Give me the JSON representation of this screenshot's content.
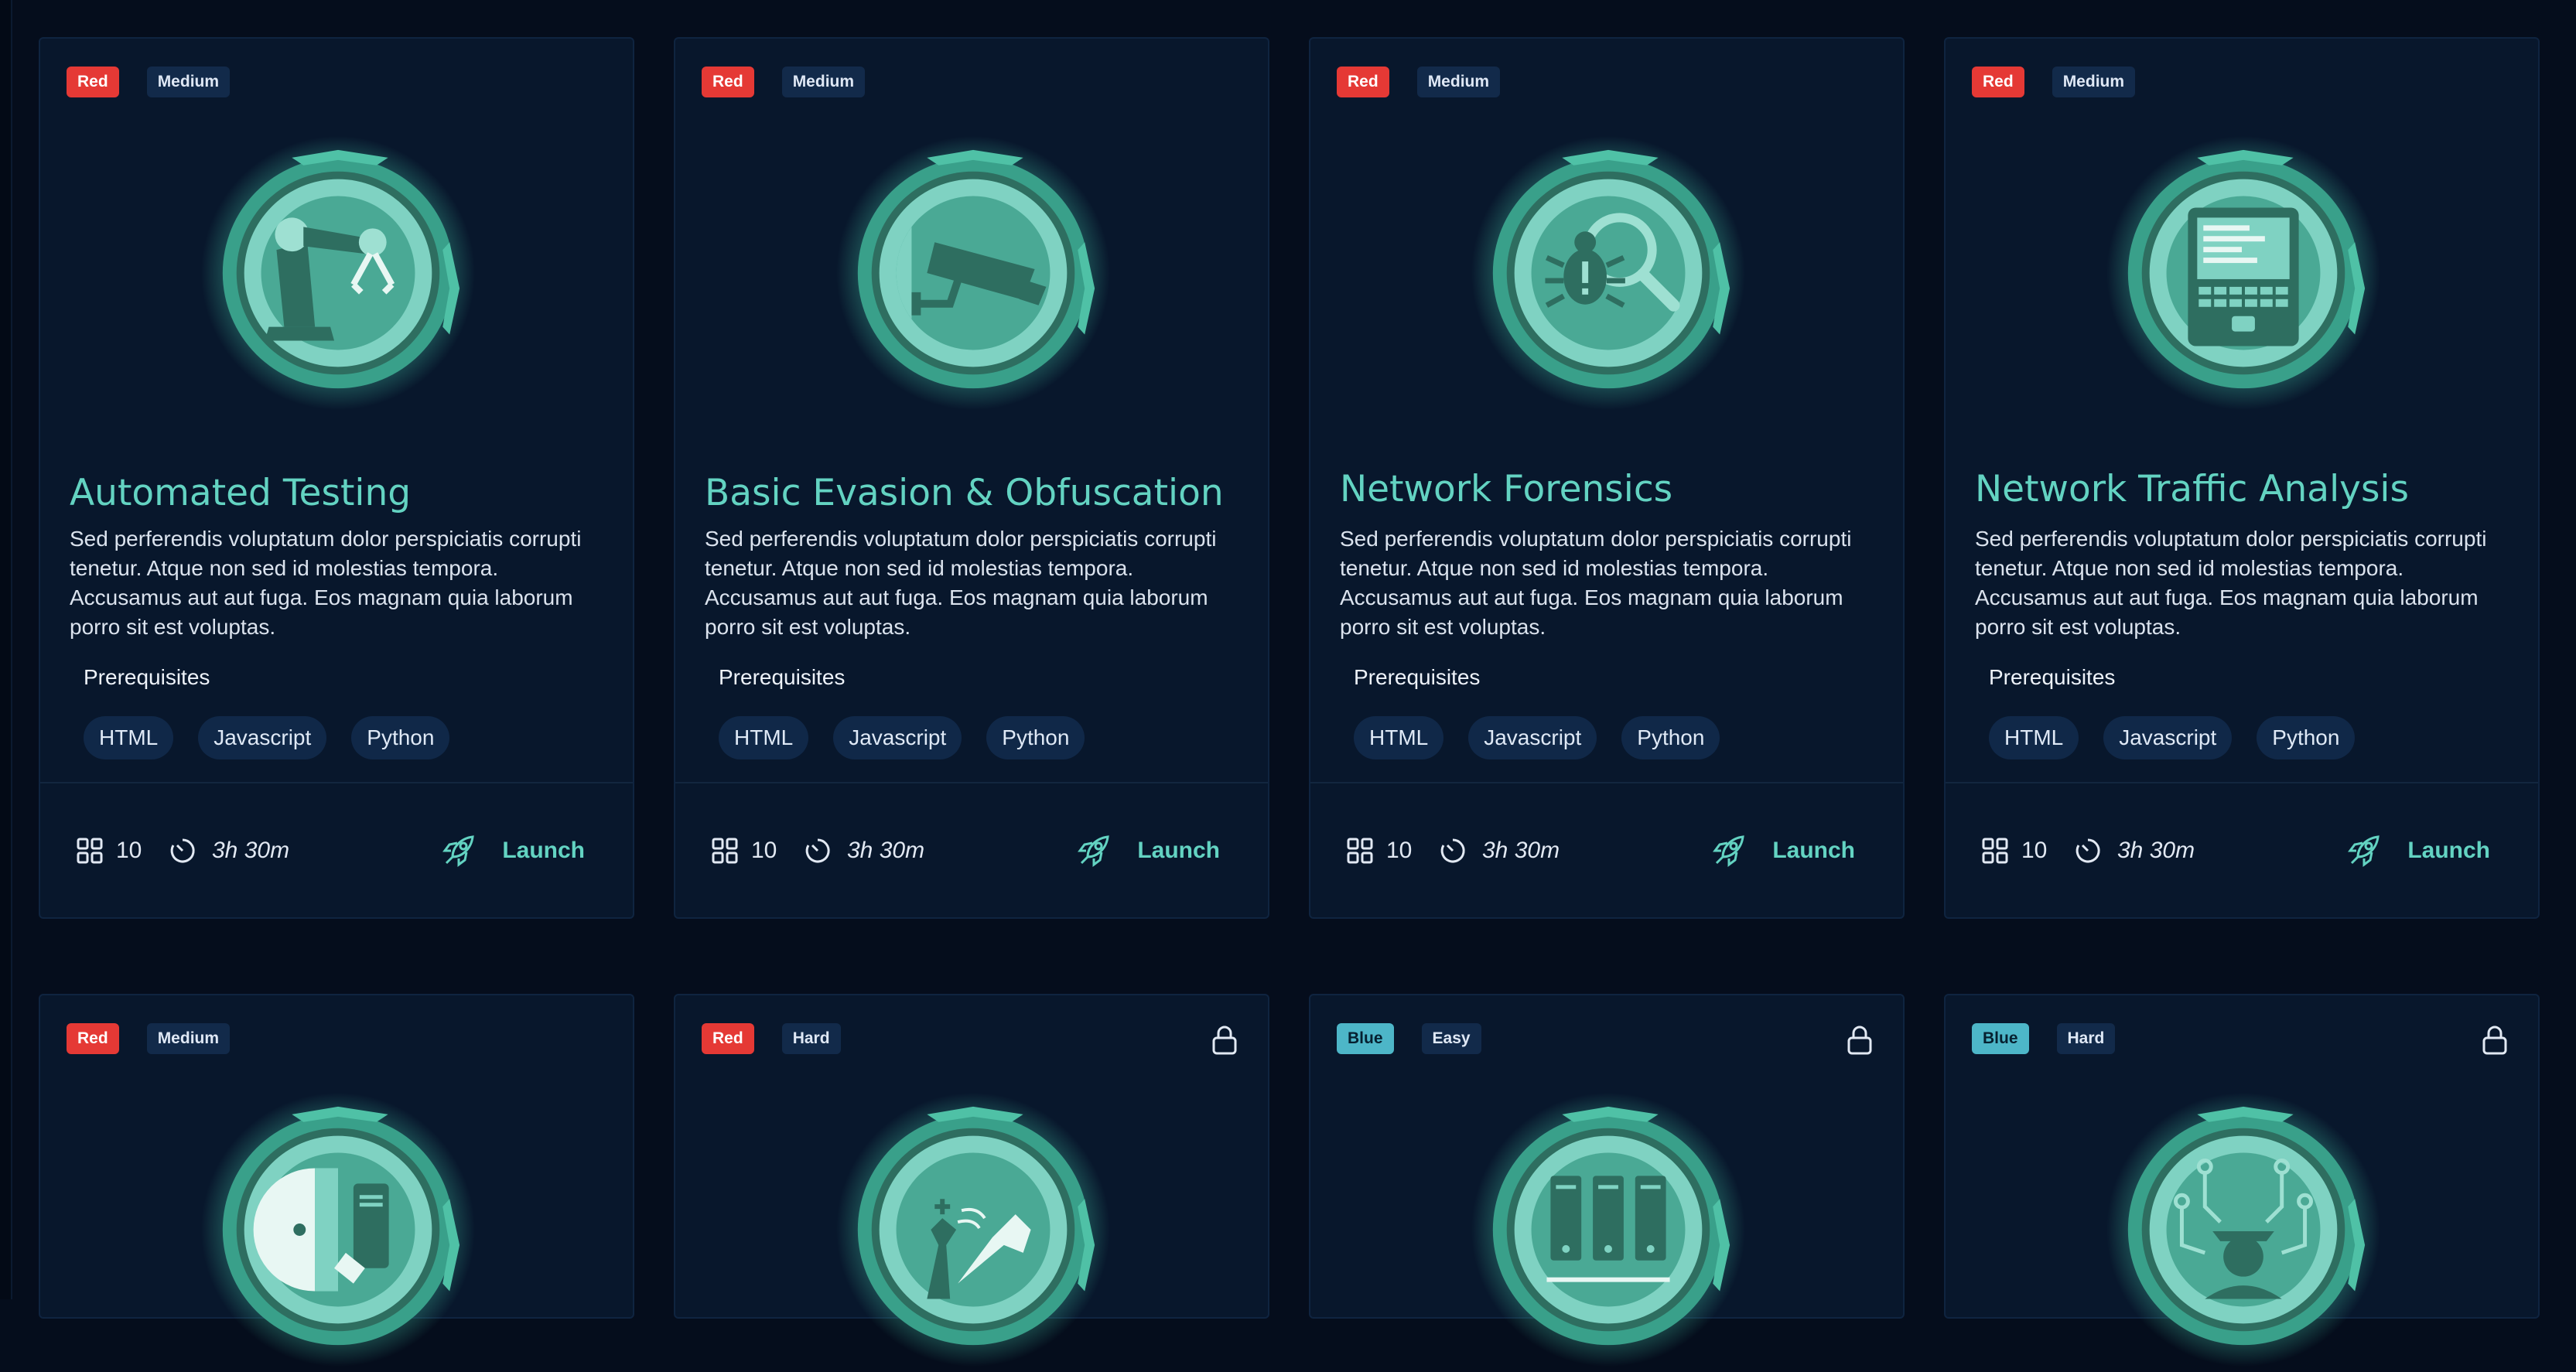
{
  "courses": [
    {
      "team": "Red",
      "difficulty": "Medium",
      "title": "Automated Testing",
      "description": "Sed perferendis voluptatum dolor perspiciatis corrupti tenetur. Atque non sed id molestias tempora. Accusamus aut aut fuga. Eos magnam quia laborum porro sit est voluptas.",
      "prerequisites_label": "Prerequisites",
      "prerequisites": [
        "HTML",
        "Javascript",
        "Python"
      ],
      "modules": "10",
      "duration": "3h 30m",
      "launch_label": "Launch",
      "icon": "robot-arm-icon",
      "locked": false
    },
    {
      "team": "Red",
      "difficulty": "Medium",
      "title": "Basic Evasion & Obfuscation",
      "description": "Sed perferendis voluptatum dolor perspiciatis corrupti tenetur. Atque non sed id molestias tempora. Accusamus aut aut fuga. Eos magnam quia laborum porro sit est voluptas.",
      "prerequisites_label": "Prerequisites",
      "prerequisites": [
        "HTML",
        "Javascript",
        "Python"
      ],
      "modules": "10",
      "duration": "3h 30m",
      "launch_label": "Launch",
      "icon": "security-camera-icon",
      "locked": false
    },
    {
      "team": "Red",
      "difficulty": "Medium",
      "title": "Network Forensics",
      "description": "Sed perferendis voluptatum dolor perspiciatis corrupti tenetur. Atque non sed id molestias tempora. Accusamus aut aut fuga. Eos magnam quia laborum porro sit est voluptas.",
      "prerequisites_label": "Prerequisites",
      "prerequisites": [
        "HTML",
        "Javascript",
        "Python"
      ],
      "modules": "10",
      "duration": "3h 30m",
      "launch_label": "Launch",
      "icon": "bug-magnifier-icon",
      "locked": false
    },
    {
      "team": "Red",
      "difficulty": "Medium",
      "title": "Network Traffic Analysis",
      "description": "Sed perferendis voluptatum dolor perspiciatis corrupti tenetur. Atque non sed id molestias tempora. Accusamus aut aut fuga. Eos magnam quia laborum porro sit est voluptas.",
      "prerequisites_label": "Prerequisites",
      "prerequisites": [
        "HTML",
        "Javascript",
        "Python"
      ],
      "modules": "10",
      "duration": "3h 30m",
      "launch_label": "Launch",
      "icon": "terminal-device-icon",
      "locked": false
    },
    {
      "team": "Red",
      "difficulty": "Medium",
      "icon": "usb-door-icon",
      "locked": false
    },
    {
      "team": "Red",
      "difficulty": "Hard",
      "icon": "chess-icon",
      "locked": true
    },
    {
      "team": "Blue",
      "difficulty": "Easy",
      "icon": "server-rack-icon",
      "locked": true
    },
    {
      "team": "Blue",
      "difficulty": "Hard",
      "icon": "hacker-circuit-icon",
      "locked": true
    }
  ],
  "colors": {
    "accent": "#63d3c2",
    "red_tag": "#e53935",
    "blue_tag": "#4db6c8",
    "card_bg": "#08172c",
    "page_bg": "#050d1c"
  }
}
